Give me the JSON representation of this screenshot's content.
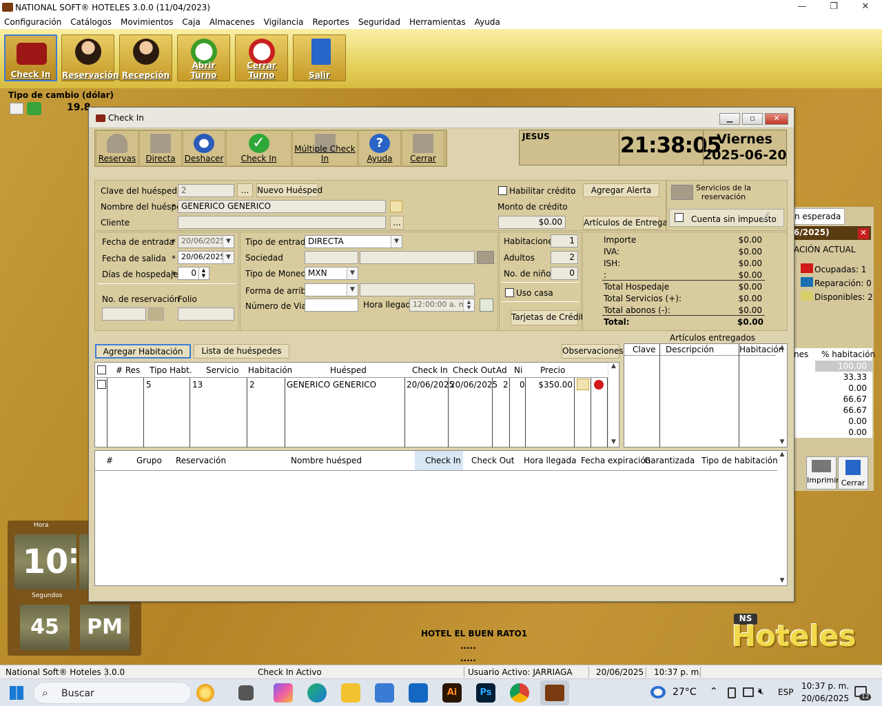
{
  "window": {
    "title": "NATIONAL SOFT® HOTELES 3.0.0 (11/04/2023)",
    "minimize": "—",
    "restore": "❐",
    "close": "✕"
  },
  "menu": [
    "Configuración",
    "Catálogos",
    "Movimientos",
    "Caja",
    "Almacenes",
    "Vigilancia",
    "Reportes",
    "Seguridad",
    "Herramientas",
    "Ayuda"
  ],
  "ribbon": [
    {
      "label": "Check In",
      "selected": true
    },
    {
      "label": "Reservación"
    },
    {
      "label": "Recepción"
    },
    {
      "label": "Abrir Turno"
    },
    {
      "label": "Cerrar Turno"
    },
    {
      "label": "Salir"
    }
  ],
  "exchange": {
    "label": "Tipo de cambio (dólar)",
    "value": "19.8"
  },
  "dialog": {
    "title": "Check In",
    "toolbar": [
      "Reservas",
      "Directa",
      "Deshacer",
      "Check In",
      "Múltiple Check In",
      "Ayuda",
      "Cerrar"
    ],
    "user": "JESUS",
    "time": "21:38:05",
    "day": "Viernes",
    "date": "2025-06-20",
    "guest": {
      "clave_label": "Clave del huésped",
      "clave": "2",
      "more": "...",
      "new_guest": "Nuevo Huésped",
      "name_label": "Nombre del huésped",
      "name": "GENERICO  GENERICO",
      "client_label": "Cliente",
      "client_more": "...",
      "required": "*"
    },
    "credit": {
      "enable_label": "Habilitar crédito",
      "alert_button": "Agregar Alerta",
      "amount_label": "Monto de crédito",
      "amount": "$0.00",
      "delivery_button": "Artículos de Entrega"
    },
    "services": {
      "label": "Servicios de la reservación",
      "no_tax": "Cuenta sin impuesto"
    },
    "dates": {
      "entry_label": "Fecha de entrada",
      "entry": "20/06/2025",
      "exit_label": "Fecha de salida",
      "exit": "20/06/2025",
      "days_label": "Días de hospedaje",
      "days": "0",
      "res_label": "No. de reservación",
      "folio_label": "Folio"
    },
    "entry": {
      "type_label": "Tipo de entrada",
      "type": "DIRECTA",
      "society_label": "Sociedad",
      "currency_label": "Tipo de Moneda",
      "currency": "MXN",
      "arrival_label": "Forma de arribo",
      "trip_label": "Número de Viaje",
      "hour_label": "Hora llegada",
      "hour": "12:00:00 a. m."
    },
    "counts": {
      "rooms_label": "Habitaciones",
      "rooms": "1",
      "adults_label": "Adultos",
      "adults": "2",
      "kids_label": "No. de niños",
      "kids": "0",
      "home_use": "Uso casa",
      "cards_button": "Tarjetas de Crédito"
    },
    "summary": [
      {
        "k": "Importe",
        "v": "$0.00"
      },
      {
        "k": "IVA:",
        "v": "$0.00"
      },
      {
        "k": "ISH:",
        "v": "$0.00"
      },
      {
        "k": ":",
        "v": "$0.00"
      },
      {
        "k": "Total Hospedaje",
        "v": "$0.00"
      },
      {
        "k": "Total Servicios (+):",
        "v": "$0.00"
      },
      {
        "k": "Total abonos (-):",
        "v": "$0.00"
      },
      {
        "k": "Total:",
        "v": "$0.00"
      }
    ],
    "tabs": {
      "add_room": "Agregar Habitación",
      "guest_list": "Lista de huéspedes",
      "observations": "Observaciones"
    },
    "rooms_table": {
      "headers": [
        "# Res",
        "Tipo Habt.",
        "Servicio",
        "Habitación",
        "Huésped",
        "Check In",
        "Check Out",
        "Ad",
        "Ni",
        "Precio"
      ],
      "rows": [
        [
          "",
          "5",
          "13",
          "2",
          "GENERICO  GENERICO",
          "20/06/2025",
          "20/06/2025",
          "2",
          "0",
          "$350.00"
        ]
      ]
    },
    "articles": {
      "title": "Artículos entregados",
      "headers": [
        "Clave",
        "Descripción",
        "Habitación"
      ]
    },
    "bottom_table": {
      "headers": [
        "#",
        "Grupo",
        "Reservación",
        "Nombre huésped",
        "Check In",
        "Check Out",
        "Hora llegada",
        "Fecha expiración",
        "Garantizada",
        "Tipo de habitación"
      ]
    }
  },
  "background": {
    "tab": "n esperada",
    "period": "6/2025)",
    "status_title": "ACIÓN ACTUAL",
    "legend": [
      {
        "label": "Ocupadas: 1",
        "color": "#d11a1a"
      },
      {
        "label": "Reparación: 0",
        "color": "#1a6fb3"
      },
      {
        "label": "Disponibles: 2",
        "color": "#d9cf6a"
      }
    ],
    "col1": "nes",
    "col2": "% habitación",
    "percents": [
      "100.00",
      "33.33",
      "0.00",
      "66.67",
      "66.67",
      "0.00",
      "0.00"
    ],
    "print": "Imprimir",
    "close": "Cerrar"
  },
  "clock": {
    "hour_label": "Hora",
    "hour": "10",
    "colon": ":",
    "seconds_label": "Segundos",
    "seconds": "45",
    "ampm": "PM"
  },
  "hotel_name": "HOTEL EL BUEN RATO1",
  "hotel_dots": ".....",
  "hotel_dots2": ".....",
  "logo": {
    "ns": "NS",
    "text": "Hoteles"
  },
  "status": {
    "app": "National Soft® Hoteles 3.0.0",
    "mode": "Check In Activo",
    "user": "Usuario Activo: JARRIAGA",
    "date": "20/06/2025",
    "time": "10:37 p. m."
  },
  "taskbar": {
    "search": "Buscar",
    "temp": "27°C",
    "lang": "ESP",
    "time": "10:37 p. m.",
    "date": "20/06/2025",
    "notif": "12"
  }
}
